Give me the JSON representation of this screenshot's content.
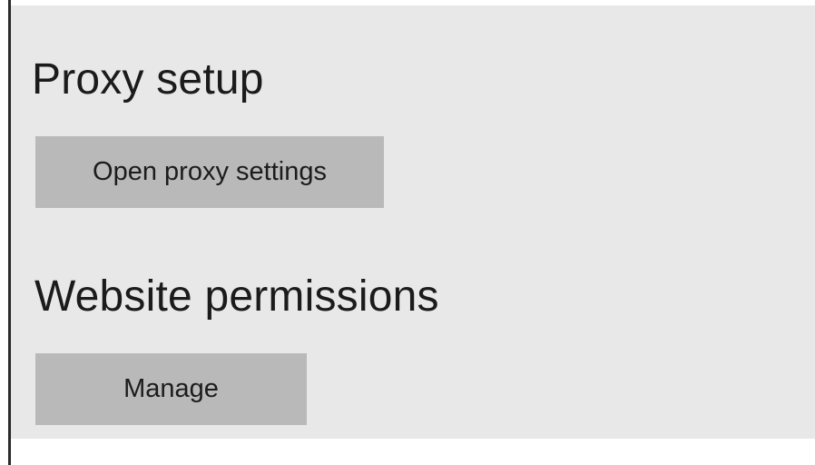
{
  "proxy_section": {
    "title": "Proxy setup",
    "button_label": "Open proxy settings"
  },
  "permissions_section": {
    "title": "Website permissions",
    "button_label": "Manage"
  },
  "colors": {
    "panel_background": "#e8e8e8",
    "button_background": "#b9b9b9",
    "text": "#1b1b1b",
    "left_border": "#2a2a2a"
  }
}
